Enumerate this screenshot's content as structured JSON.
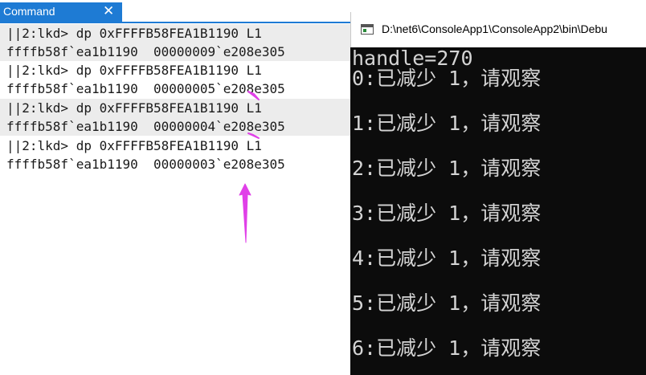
{
  "command_window": {
    "tab_label": "Command",
    "close_glyph": "✕",
    "lines": [
      "||2:lkd> dp 0xFFFFB58FEA1B1190 L1",
      "ffffb58f`ea1b1190  00000009`e208e305",
      "||2:lkd> dp 0xFFFFB58FEA1B1190 L1",
      "ffffb58f`ea1b1190  00000005`e208e305",
      "||2:lkd> dp 0xFFFFB58FEA1B1190 L1",
      "ffffb58f`ea1b1190  00000004`e208e305",
      "||2:lkd> dp 0xFFFFB58FEA1B1190 L1",
      "ffffb58f`ea1b1190  00000003`e208e305"
    ]
  },
  "console_window": {
    "title": "D:\\net6\\ConsoleApp1\\ConsoleApp2\\bin\\Debu",
    "lines": [
      "handle=270",
      "0:已减少 1，请观察",
      "1:已减少 1，请观察",
      "2:已减少 1，请观察",
      "3:已减少 1，请观察",
      "4:已减少 1，请观察",
      "5:已减少 1，请观察",
      "6:已减少 1，请观察"
    ]
  },
  "annotation_color": "#e040e8"
}
